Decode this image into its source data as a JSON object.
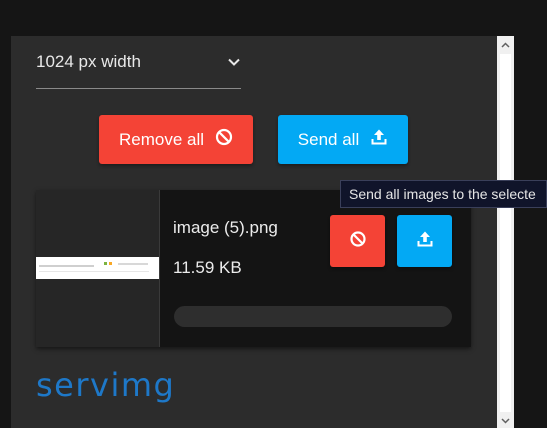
{
  "size_select": {
    "value": "1024 px width"
  },
  "actions": {
    "remove_all_label": "Remove all",
    "send_all_label": "Send all"
  },
  "tooltip": {
    "text": "Send all images to the selecte"
  },
  "file": {
    "name": "image (5).png",
    "size": "11.59 KB",
    "progress": 0
  },
  "logo": {
    "text": "servimg"
  },
  "colors": {
    "remove": "#f44336",
    "send": "#03a9f4",
    "logo": "#1e78c8",
    "panel": "#2c2c2c"
  },
  "icons": {
    "remove": "block-icon",
    "send": "upload-icon",
    "select": "chevron-down-icon"
  }
}
